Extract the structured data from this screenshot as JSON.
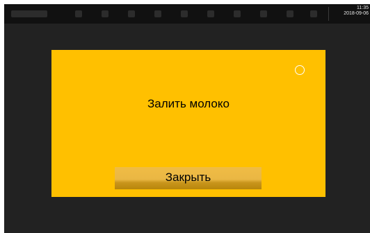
{
  "status_bar": {
    "time": "11:35",
    "date": "2018-09-06",
    "icons": [
      "status-icon",
      "status-icon",
      "status-icon",
      "status-icon",
      "status-icon",
      "status-icon",
      "status-icon",
      "status-icon",
      "status-icon",
      "status-icon"
    ]
  },
  "dialog": {
    "message": "Залить молоко",
    "close_label": "Закрыть",
    "background_color": "#ffc000"
  }
}
